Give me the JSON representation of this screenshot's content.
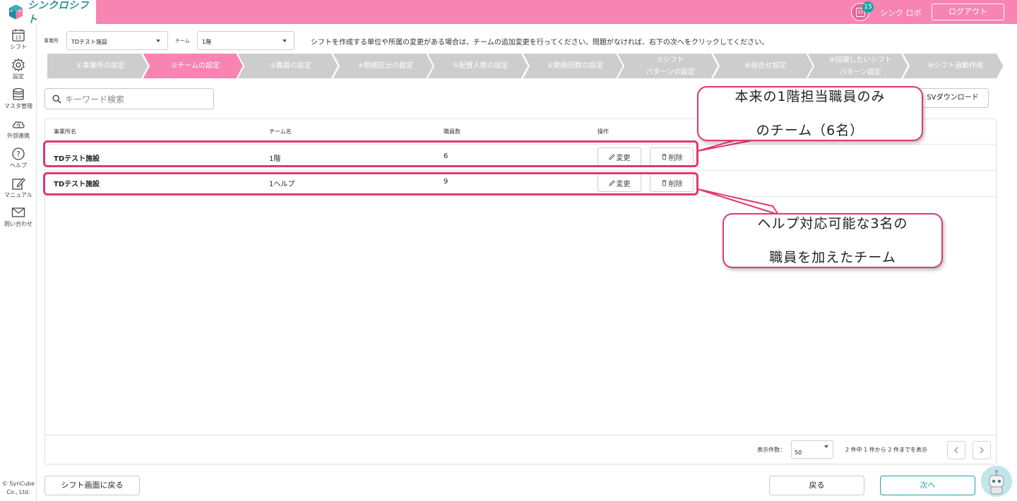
{
  "app": {
    "logo_text": "シンクロシフト",
    "calendar_icon_label": "15",
    "notification_count": "15",
    "user_name": "シンク ロボ",
    "logout_label": "ログアウト"
  },
  "sidebar": {
    "calendar_label": "15",
    "items": [
      {
        "label": "シフト",
        "icon": "calendar-icon"
      },
      {
        "label": "設定",
        "icon": "gear-icon"
      },
      {
        "label": "マスタ管理",
        "icon": "database-icon"
      },
      {
        "label": "外部連携",
        "icon": "cloud-sync-icon"
      },
      {
        "label": "ヘルプ",
        "icon": "help-icon"
      },
      {
        "label": "マニュアル",
        "icon": "edit-icon"
      },
      {
        "label": "問い合わせ",
        "icon": "mail-icon"
      }
    ],
    "copyright_line1": "© SynCube",
    "copyright_line2": "Co., Ltd."
  },
  "filters": {
    "office_label": "事業所",
    "office_value": "TDテスト施設",
    "team_label": "チーム",
    "team_value": "1階",
    "instruction": "シフトを作成する単位や所属の変更がある場合は、チームの追加変更を行ってください。問題がなければ、右下の次へをクリックしてください。"
  },
  "steps": [
    {
      "line1": "①事業所の設定",
      "line2": ""
    },
    {
      "line1": "②チームの設定",
      "line2": ""
    },
    {
      "line1": "③職員の設定",
      "line2": ""
    },
    {
      "line1": "④勤務区分の設定",
      "line2": ""
    },
    {
      "line1": "⑤配置人数の設定",
      "line2": ""
    },
    {
      "line1": "⑥勤務回数の設定",
      "line2": ""
    },
    {
      "line1": "⑦シフト",
      "line2": "パターンの設定"
    },
    {
      "line1": "⑧組合せ設定",
      "line2": ""
    },
    {
      "line1": "⑨回避したいシフト",
      "line2": "パターン設定"
    },
    {
      "line1": "⑩シフト自動作成",
      "line2": ""
    }
  ],
  "active_step": 1,
  "colors": {
    "accent": "#f884b2",
    "step_inactive": "#cdcdcd",
    "teal": "#17a6a3",
    "annotation": "#e2386f"
  },
  "search": {
    "placeholder": "キーワード検索"
  },
  "csv_button": "SVダウンロード",
  "table": {
    "headers": [
      "事業所名",
      "チーム名",
      "職員数",
      "操作"
    ],
    "rows": [
      {
        "office": "TDテスト施設",
        "team": "1階",
        "count": "6",
        "edit": "変更",
        "delete": "削除"
      },
      {
        "office": "TDテスト施設",
        "team": "1ヘルプ",
        "count": "9",
        "edit": "変更",
        "delete": "削除"
      }
    ],
    "per_page_label": "表示件数：",
    "per_page_value": "50",
    "page_info": "2 件中 1 件から 2 件までを表示"
  },
  "buttons": {
    "back_to_shift": "シフト画面に戻る",
    "back": "戻る",
    "next": "次へ"
  },
  "annotations": {
    "callout1_line1": "本来の1階担当職員のみ",
    "callout1_line2": "のチーム（6名）",
    "callout2_line1": "ヘルプ対応可能な3名の",
    "callout2_line2": "職員を加えたチーム"
  }
}
